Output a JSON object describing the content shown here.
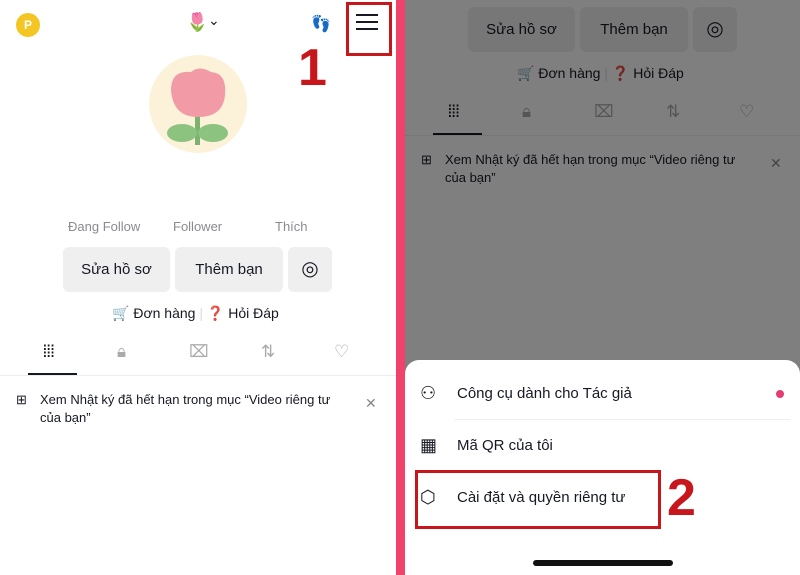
{
  "profile": {
    "coin_icon": "P",
    "account_emoji": "🌷",
    "stats": [
      "Đang Follow",
      "Follower",
      "Thích"
    ],
    "edit_profile": "Sửa hồ sơ",
    "add_friend": "Thêm bạn",
    "orders": "Đơn hàng",
    "qa": "Hỏi Đáp",
    "notice": "Xem Nhật ký đã hết hạn trong mục “Video riêng tư của bạn”"
  },
  "sheet": {
    "items": [
      {
        "label": "Công cụ dành cho Tác giả",
        "icon": "creator-tools-icon"
      },
      {
        "label": "Mã QR của tôi",
        "icon": "qr-code-icon"
      },
      {
        "label": "Cài đặt và quyền riêng tư",
        "icon": "settings-icon"
      }
    ]
  },
  "steps": {
    "one": "1",
    "two": "2"
  },
  "colors": {
    "accent": "#e33d72",
    "annotation": "#c8161d",
    "divider": "#f1426b"
  }
}
